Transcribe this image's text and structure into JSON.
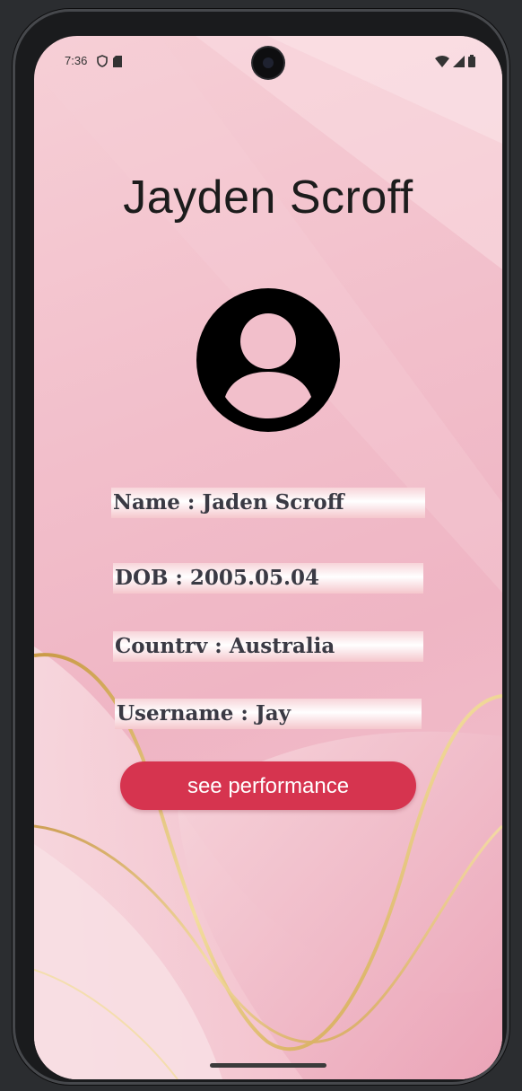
{
  "status_bar": {
    "time": "7:36",
    "left_icons": [
      "shield-icon",
      "sim-card-icon"
    ],
    "right_icons": [
      "wifi-icon",
      "signal-icon",
      "battery-icon"
    ]
  },
  "profile": {
    "title": "Jayden Scroff",
    "avatar_icon": "account-circle-icon",
    "fields": [
      "Name : Jaden Scroff",
      "DOB : 2005.05.04",
      "Countrv : Australia",
      "Username : Jay"
    ],
    "button_label": "see performance"
  },
  "colors": {
    "accent": "#d6344f",
    "background": "#f2bfcb",
    "gold_wave": "#d9b25f"
  }
}
